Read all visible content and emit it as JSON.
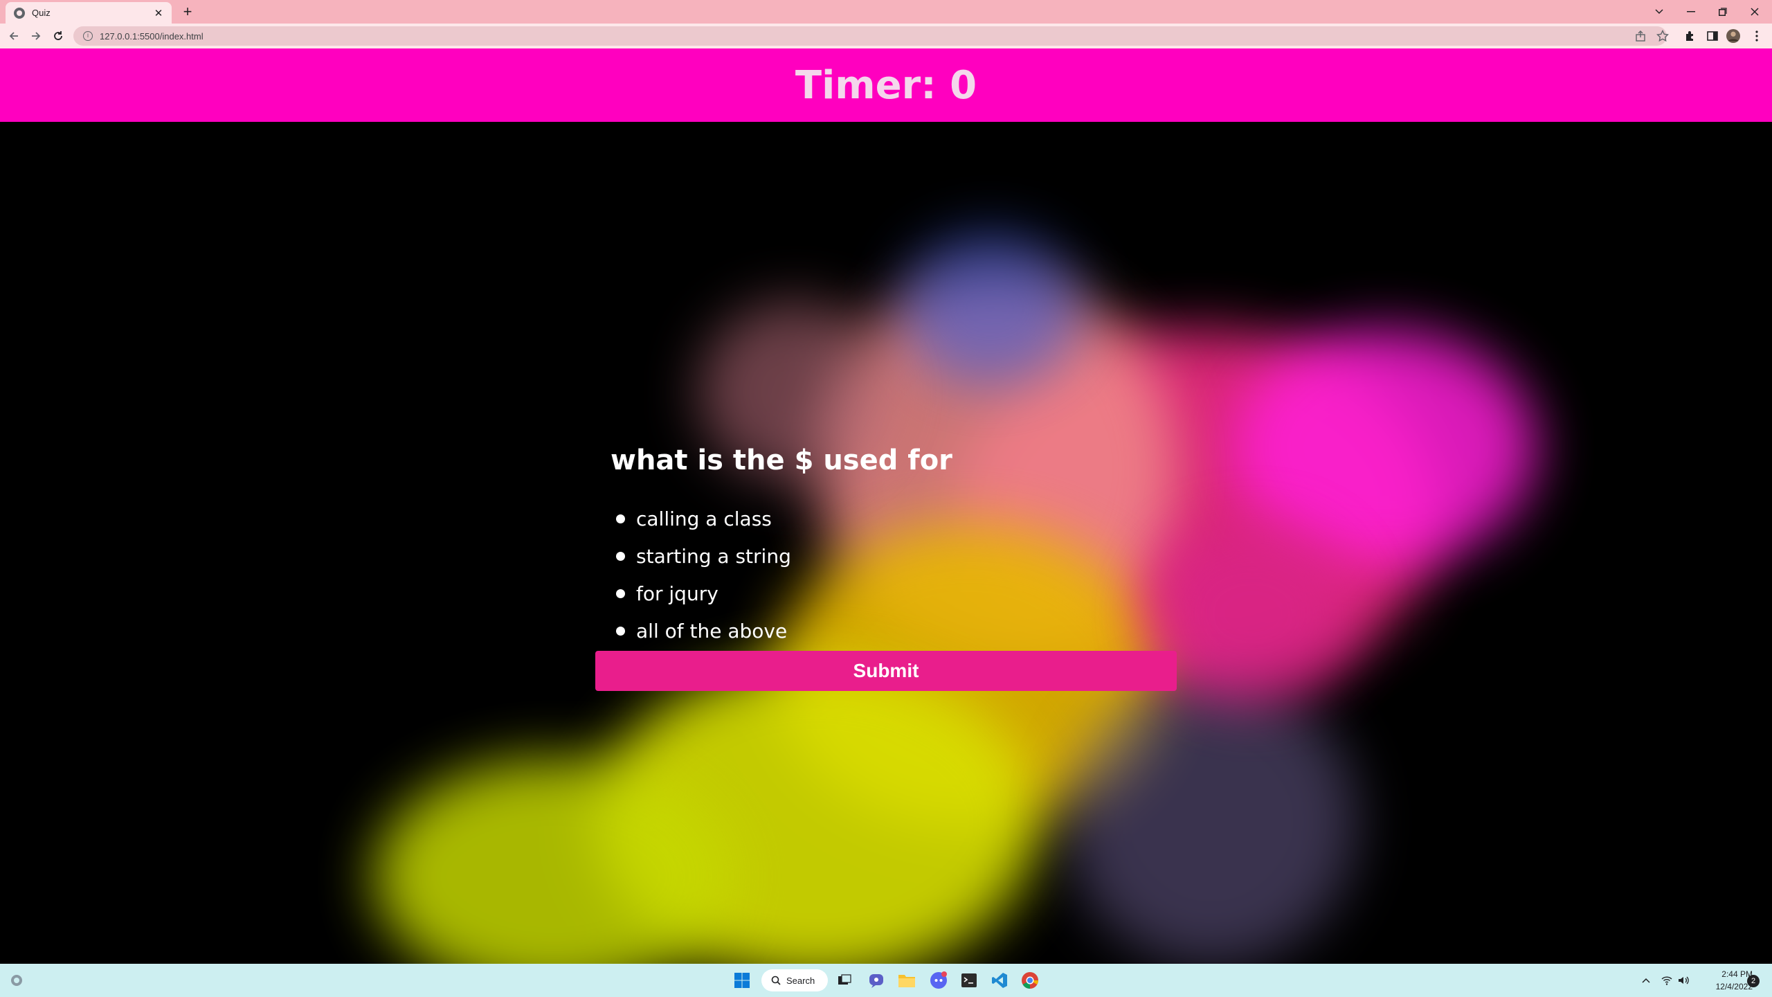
{
  "browser": {
    "tab_title": "Quiz",
    "url": "127.0.0.1:5500/index.html",
    "new_tab_label": "+"
  },
  "page": {
    "timer_text": "Timer: 0",
    "question": "what is the $ used for",
    "choices": [
      "calling a class",
      "starting a string",
      "for jqury",
      "all of the above"
    ],
    "submit_label": "Submit",
    "header_color": "#ff00bf",
    "submit_color": "#e91e8c"
  },
  "taskbar": {
    "search_label": "Search",
    "time": "2:44 PM",
    "date": "12/4/2022",
    "notification_count": "2"
  }
}
